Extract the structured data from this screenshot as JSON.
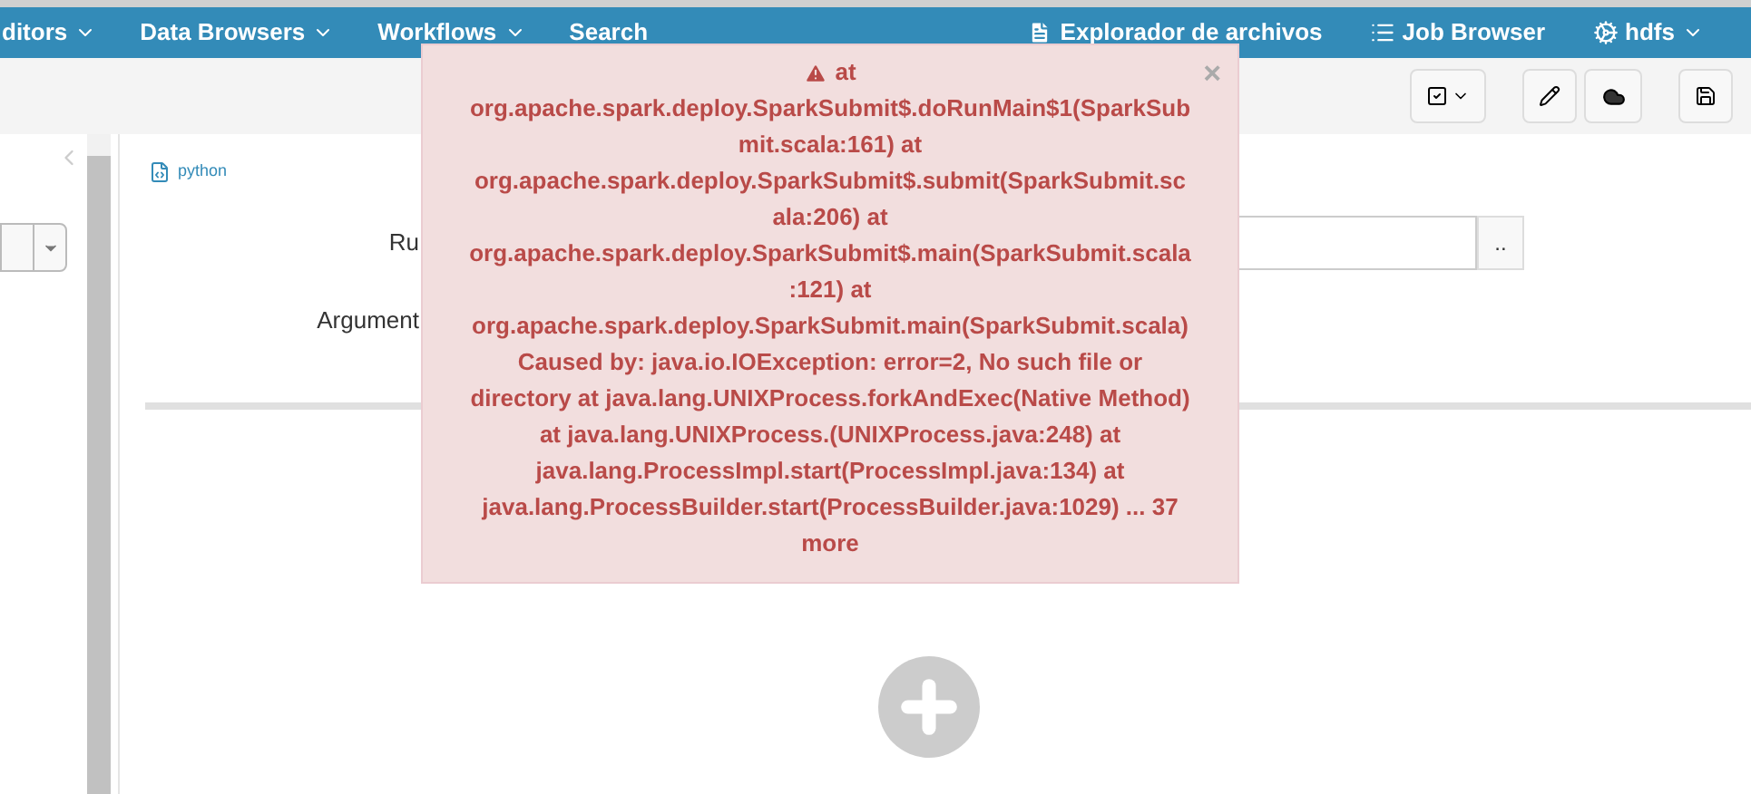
{
  "nav": {
    "left": [
      {
        "label": "ditors",
        "dropdown": true
      },
      {
        "label": "Data Browsers",
        "dropdown": true
      },
      {
        "label": "Workflows",
        "dropdown": true
      },
      {
        "label": "Search",
        "dropdown": false
      }
    ],
    "right": [
      {
        "label": "Explorador de archivos",
        "kind": "file",
        "dropdown": false
      },
      {
        "label": "Job Browser",
        "kind": "list",
        "dropdown": false
      },
      {
        "label": "hdfs",
        "kind": "cogs",
        "dropdown": true
      }
    ]
  },
  "snippet": {
    "type": "python"
  },
  "form": {
    "labels": [
      "Ru",
      "Argument"
    ],
    "browse": ".."
  },
  "alert": {
    "close": "×",
    "lines": [
      "at",
      "org.apache.spark.deploy.SparkSubmit$.doRunMain$1(SparkSub",
      "mit.scala:161) at",
      "org.apache.spark.deploy.SparkSubmit$.submit(SparkSubmit.sc",
      "ala:206) at",
      "org.apache.spark.deploy.SparkSubmit$.main(SparkSubmit.scala",
      ":121) at",
      "org.apache.spark.deploy.SparkSubmit.main(SparkSubmit.scala)",
      "Caused by: java.io.IOException: error=2, No such file or",
      "directory at java.lang.UNIXProcess.forkAndExec(Native Method)",
      "at java.lang.UNIXProcess.(UNIXProcess.java:248) at",
      "java.lang.ProcessImpl.start(ProcessImpl.java:134) at",
      "java.lang.ProcessBuilder.start(ProcessBuilder.java:1029) ... 37",
      "more"
    ]
  }
}
